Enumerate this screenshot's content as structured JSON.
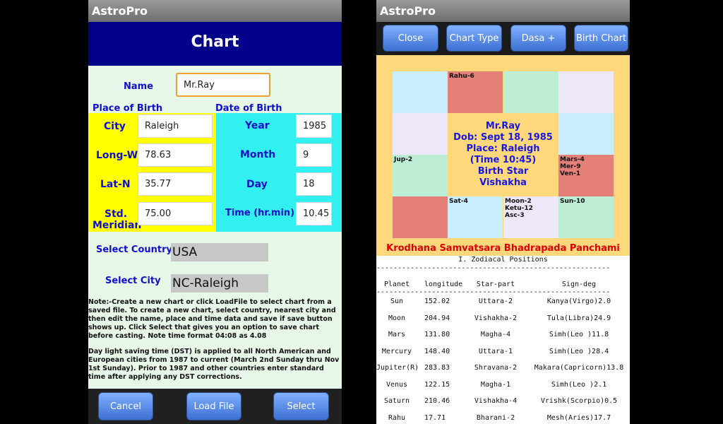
{
  "left": {
    "app_title": "AstroPro",
    "header": "Chart",
    "name_label": "Name",
    "name_value": "Mr.Ray",
    "place_of_birth_label": "Place of Birth",
    "date_of_birth_label": "Date of Birth",
    "city_label": "City",
    "city_value": "Raleigh",
    "long_label": "Long-W",
    "long_value": "78.63",
    "lat_label": "Lat-N",
    "lat_value": "35.77",
    "std_label_1": "Std.",
    "std_label_2": "Meridian",
    "std_value": "75.00",
    "year_label": "Year",
    "year_value": "1985",
    "month_label": "Month",
    "month_value": "9",
    "day_label": "Day",
    "day_value": "18",
    "time_label": "Time (hr.min)",
    "time_value": "10.45",
    "select_country_label": "Select Country",
    "select_country_value": "USA",
    "select_city_label": "Select City",
    "select_city_value": "NC-Raleigh",
    "note1": "Note:-Create a new chart or click LoadFile to select chart from a saved file. To create a new chart, select country, nearest city and then edit the name, place and time data and save if save button shows up. Click Select that gives you an option to save chart before casting. Note time format 04:08 as 4.08",
    "note2": "Day light saving time (DST) is applied to all North American and European cities from 1987 to current (March 2nd Sunday thru Nov 1st Sunday). Prior to 1987 and other countries enter standard time after applying any DST corrections.",
    "buttons": {
      "cancel": "Cancel",
      "load_file": "Load File",
      "select": "Select"
    }
  },
  "right": {
    "app_title": "AstroPro",
    "buttons": {
      "close": "Close",
      "chart_type": "Chart Type",
      "dasa": "Dasa +",
      "birth_chart": "Birth Chart"
    },
    "cells": {
      "rahu": "Rahu-6",
      "jup": "Jup-2",
      "mars_1": "Mars-4",
      "mars_2": "Mer-9",
      "mars_3": "Ven-1",
      "sat": "Sat-4",
      "moon_1": "Moon-2",
      "moon_2": "Ketu-12",
      "moon_3": "Asc-3",
      "sun": "Sun-10"
    },
    "center": {
      "name": "Mr.Ray",
      "dob": "Dob: Sept 18, 1985",
      "place": "Place: Raleigh",
      "time": "(Time 10:45)",
      "birth_star_label": "Birth Star",
      "birth_star": "Vishakha"
    },
    "samvatsara": "Krodhana Samvatsara Bhadrapada Panchami",
    "zodiac_title": "I. Zodiacal Positions",
    "dashes": "-------------------------------------------------------",
    "table": {
      "headers": [
        "Planet",
        "longitude",
        "Star-part",
        "Sign-deg"
      ],
      "rows": [
        [
          "Sun",
          "152.02",
          "Uttara-2",
          "Kanya(Virgo)2.0"
        ],
        [
          "Moon",
          "204.94",
          "Vishakha-2",
          "Tula(Libra)24.9"
        ],
        [
          "Mars",
          "131.80",
          "Magha-4",
          "Simh(Leo )11.8"
        ],
        [
          "Mercury",
          "148.40",
          "Uttara-1",
          "Simh(Leo )28.4"
        ],
        [
          "Jupiter(R)",
          "283.83",
          "Shravana-2",
          "Makara(Capricorn)13.8"
        ],
        [
          "Venus",
          "122.15",
          "Magha-1",
          "Simh(Leo )2.1"
        ],
        [
          "Saturn",
          "210.46",
          "Vishakha-4",
          "Vrishk(Scorpio)0.5"
        ],
        [
          "Rahu",
          "17.71",
          "Bharani-2",
          "Mesh(Aries)17.7"
        ]
      ]
    }
  }
}
